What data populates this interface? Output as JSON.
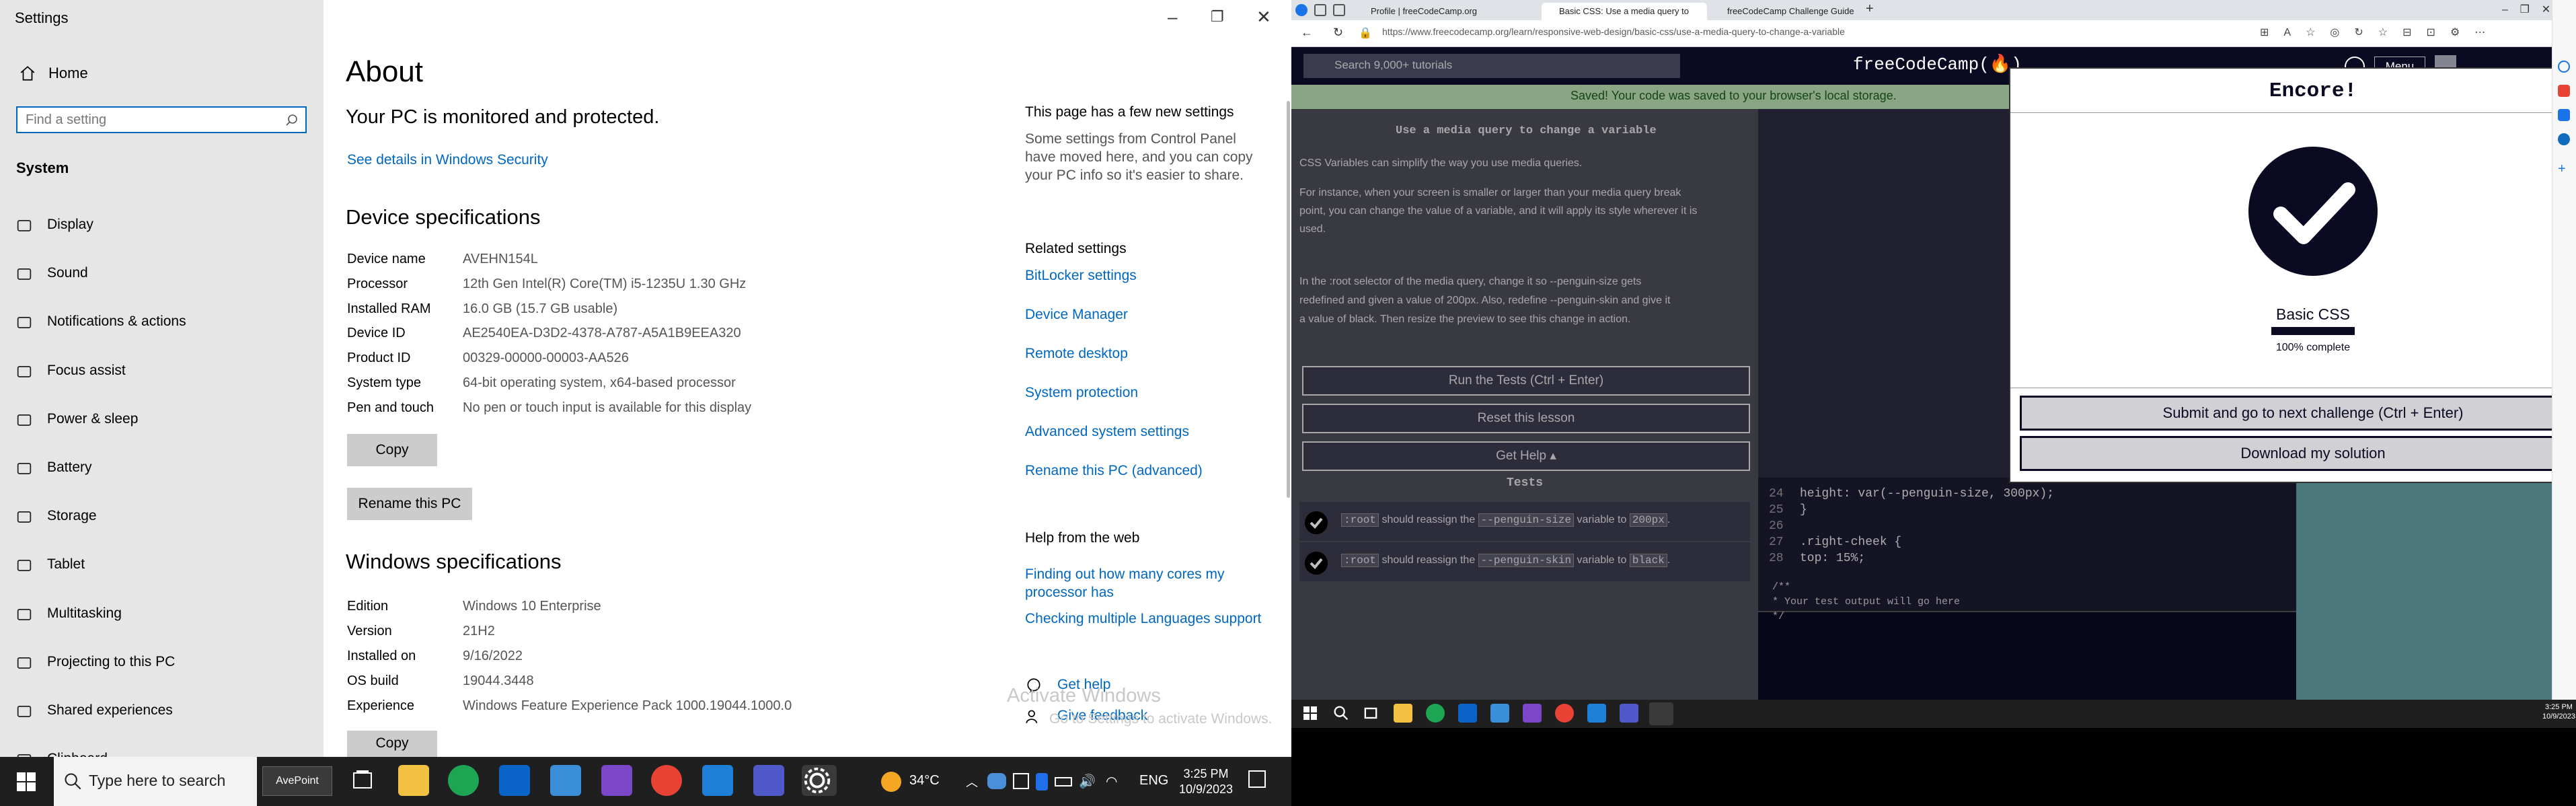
{
  "settings": {
    "window_title": "Settings",
    "home_label": "Home",
    "search_placeholder": "Find a setting",
    "section_label": "System",
    "nav_items": [
      {
        "label": "Display",
        "icon": "display-icon"
      },
      {
        "label": "Sound",
        "icon": "sound-icon"
      },
      {
        "label": "Notifications & actions",
        "icon": "notifications-icon"
      },
      {
        "label": "Focus assist",
        "icon": "moon-icon"
      },
      {
        "label": "Power & sleep",
        "icon": "power-icon"
      },
      {
        "label": "Battery",
        "icon": "battery-icon"
      },
      {
        "label": "Storage",
        "icon": "storage-icon"
      },
      {
        "label": "Tablet",
        "icon": "tablet-icon"
      },
      {
        "label": "Multitasking",
        "icon": "multitasking-icon"
      },
      {
        "label": "Projecting to this PC",
        "icon": "projector-icon"
      },
      {
        "label": "Shared experiences",
        "icon": "shared-icon"
      },
      {
        "label": "Clipboard",
        "icon": "clipboard-icon"
      }
    ],
    "page_title": "About",
    "protection_text": "Your PC is monitored and protected.",
    "security_link": "See details in Windows Security",
    "device_specs_title": "Device specifications",
    "device_specs": [
      {
        "key": "Device name",
        "value": "AVEHN154L"
      },
      {
        "key": "Processor",
        "value": "12th Gen Intel(R) Core(TM) i5-1235U   1.30 GHz"
      },
      {
        "key": "Installed RAM",
        "value": "16.0 GB (15.7 GB usable)"
      },
      {
        "key": "Device ID",
        "value": "AE2540EA-D3D2-4378-A787-A5A1B9EEA320"
      },
      {
        "key": "Product ID",
        "value": "00329-00000-00003-AA526"
      },
      {
        "key": "System type",
        "value": "64-bit operating system, x64-based processor"
      },
      {
        "key": "Pen and touch",
        "value": "No pen or touch input is available for this display"
      }
    ],
    "copy_label": "Copy",
    "rename_label": "Rename this PC",
    "windows_specs_title": "Windows specifications",
    "windows_specs": [
      {
        "key": "Edition",
        "value": "Windows 10 Enterprise"
      },
      {
        "key": "Version",
        "value": "21H2"
      },
      {
        "key": "Installed on",
        "value": "9/16/2022"
      },
      {
        "key": "OS build",
        "value": "19044.3448"
      },
      {
        "key": "Experience",
        "value": "Windows Feature Experience Pack 1000.19044.1000.0"
      }
    ],
    "copy2_label": "Copy",
    "side_title": "This page has a few new settings",
    "side_text": "Some settings from Control Panel have moved here, and you can copy your PC info so it's easier to share.",
    "related_title": "Related settings",
    "related_links": [
      "BitLocker settings",
      "Device Manager",
      "Remote desktop",
      "System protection",
      "Advanced system settings",
      "Rename this PC (advanced)"
    ],
    "help_title": "Help from the web",
    "help_links": [
      "Finding out how many cores my processor has",
      "Checking multiple Languages support"
    ],
    "get_help": "Get help",
    "give_feedback": "Give feedback",
    "activate_title": "Activate Windows",
    "activate_sub": "Go to Settings to activate Windows."
  },
  "taskbar_left": {
    "search_text": "Type here to search",
    "avepoint_label": "AvePoint",
    "weather": "34°C",
    "lang": "ENG",
    "time": "3:25 PM",
    "date": "10/9/2023"
  },
  "browser": {
    "tabs": [
      {
        "label": "Profile | freeCodeCamp.org",
        "active": false
      },
      {
        "label": "Basic CSS: Use a media query to",
        "active": true
      },
      {
        "label": "freeCodeCamp Challenge Guide",
        "active": false
      }
    ],
    "url": "https://www.freecodecamp.org/learn/responsive-web-design/basic-css/use-a-media-query-to-change-a-variable",
    "fcc_search_placeholder": "Search 9,000+ tutorials",
    "fcc_logo": "freeCodeCamp(🔥)",
    "menu_label": "Menu",
    "saved_text": "Saved! Your code was saved to your browser's local storage.",
    "lesson_title": "Use a media query to change a variable",
    "lesson_p1": "CSS Variables can simplify the way you use media queries.",
    "lesson_p2a": "For instance, when your screen is smaller or larger than your media query break",
    "lesson_p2b": "point, you can change the value of a variable, and it will apply its style wherever it is",
    "lesson_p2c": "used.",
    "lesson_p3a": "In the :root selector of the media query, change it so --penguin-size gets",
    "lesson_p3b": "redefined and given a value of 200px. Also, redefine --penguin-skin and give it",
    "lesson_p3c": "a value of black. Then resize the preview to see this change in action.",
    "run_tests": "Run the Tests (Ctrl + Enter)",
    "reset_lesson": "Reset this lesson",
    "get_help": "Get Help ▴",
    "tests_heading": "Tests",
    "tests": [
      {
        "pre": ":root",
        "mid": " should reassign the ",
        "var": "--penguin-size",
        "post": " variable to ",
        "val": "200px",
        "end": "."
      },
      {
        "pre": ":root",
        "mid": " should reassign the ",
        "var": "--penguin-skin",
        "post": " variable to ",
        "val": "black",
        "end": "."
      }
    ],
    "code_lines": [
      {
        "num": "24",
        "text": "    height: var(--penguin-size, 300px);"
      },
      {
        "num": "25",
        "text": "  }"
      },
      {
        "num": "26",
        "text": ""
      },
      {
        "num": "27",
        "text": "  .right-cheek {"
      },
      {
        "num": "28",
        "text": "    top: 15%;"
      }
    ],
    "output_lines": [
      "/**",
      "* Your test output will go here",
      "*/"
    ],
    "modal": {
      "title": "Encore!",
      "cert_title": "Basic CSS",
      "progress_text": "100% complete",
      "progress_fraction": 1.0,
      "submit_label": "Submit and go to next challenge (Ctrl + Enter)",
      "download_label": "Download my solution"
    }
  },
  "taskbar_right": {
    "time": "3:25 PM",
    "date": "10/9/2023"
  },
  "colors": {
    "win_accent": "#0067c0",
    "fcc_dark": "#0a0a23",
    "fcc_green": "#b7dcb1",
    "preview_bg": "#63a0a6"
  }
}
